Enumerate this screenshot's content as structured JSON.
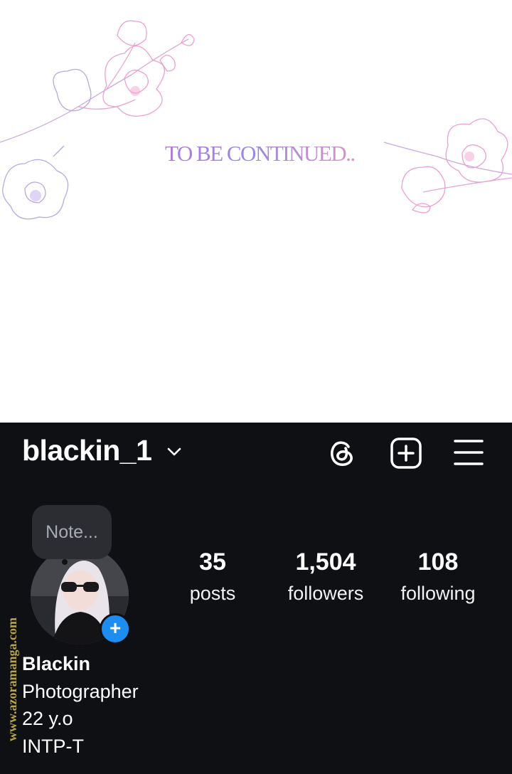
{
  "panel": {
    "caption": "TO BE CONTINUED.."
  },
  "profile": {
    "username": "blackin_1",
    "icons": {
      "dropdown": "chevron-down-icon",
      "threads": "threads-icon",
      "new_post": "plus-square-icon",
      "menu": "hamburger-menu-icon"
    },
    "note_placeholder": "Note...",
    "add_story": "+",
    "stats": {
      "posts": {
        "value": "35",
        "label": "posts"
      },
      "followers": {
        "value": "1,504",
        "label": "followers"
      },
      "following": {
        "value": "108",
        "label": "following"
      }
    },
    "bio": {
      "name": "Blackin",
      "line1": "Photographer",
      "line2": "22 y.o",
      "line3": "INTP-T"
    }
  },
  "watermark": "www.azoramanga.com",
  "colors": {
    "profile_bg": "#0f1014",
    "note_bg": "#2b2d33",
    "accent_blue": "#1d8df2",
    "caption_gradient": [
      "#b07cd8",
      "#d792c8"
    ]
  }
}
